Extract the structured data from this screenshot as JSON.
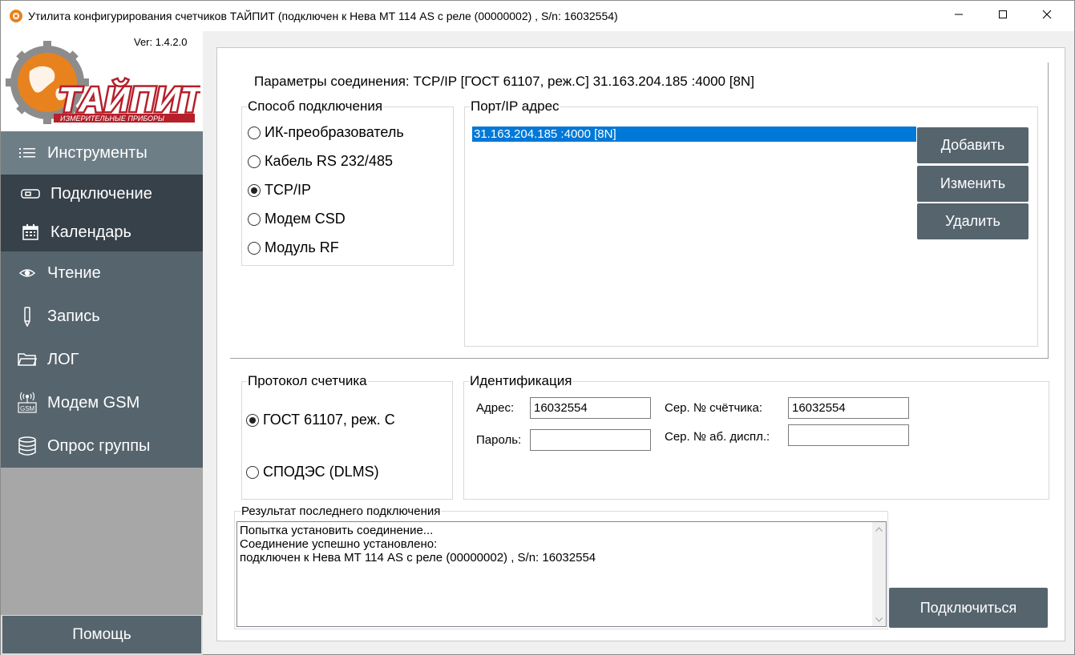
{
  "window": {
    "title": "Утилита конфигурирования счетчиков ТАЙПИТ (подключен к Нева МТ 114 AS с реле (00000002) , S/n: 16032554)",
    "controls": {
      "minimize": "minimize-icon",
      "maximize": "maximize-icon",
      "close": "close-icon"
    }
  },
  "sidebar": {
    "version": "Ver: 1.4.2.0",
    "logo_text": "ТАЙПИТ",
    "logo_subtext": "ИЗМЕРИТЕЛЬНЫЕ ПРИБОРЫ",
    "items": [
      {
        "label": "Инструменты",
        "icon": "list-icon"
      },
      {
        "label": "Подключение",
        "icon": "connector-icon",
        "active": true
      },
      {
        "label": "Календарь",
        "icon": "calendar-icon"
      },
      {
        "label": "Чтение",
        "icon": "eye-icon"
      },
      {
        "label": "Запись",
        "icon": "pencil-icon"
      },
      {
        "label": "ЛОГ",
        "icon": "folder-icon"
      },
      {
        "label": "Модем GSM",
        "icon": "gsm-icon"
      },
      {
        "label": "Опрос группы",
        "icon": "database-icon"
      }
    ],
    "help_label": "Помощь"
  },
  "main": {
    "connection_params": "Параметры соединения: TCP/IP [ГОСТ 61107, реж.С] 31.163.204.185 :4000 [8N]",
    "method_group": {
      "title": "Способ подключения",
      "options": [
        {
          "label": "ИК-преобразователь",
          "checked": false
        },
        {
          "label": "Кабель RS 232/485",
          "checked": false
        },
        {
          "label": "TCP/IP",
          "checked": true
        },
        {
          "label": "Модем CSD",
          "checked": false
        },
        {
          "label": "Модуль RF",
          "checked": false
        }
      ]
    },
    "port_group": {
      "title": "Порт/IP адрес",
      "entries": [
        "31.163.204.185 :4000 [8N]"
      ],
      "add_label": "Добавить",
      "edit_label": "Изменить",
      "delete_label": "Удалить"
    },
    "protocol_group": {
      "title": "Протокол счетчика",
      "options": [
        {
          "label": "ГОСТ 61107, реж. С",
          "checked": true
        },
        {
          "label": "СПОДЭС (DLMS)",
          "checked": false
        }
      ]
    },
    "ident_group": {
      "title": "Идентификация",
      "address_label": "Адрес:",
      "address_value": "16032554",
      "password_label": "Пароль:",
      "password_value": "",
      "serial_label": "Сер. № счётчика:",
      "serial_value": "16032554",
      "display_serial_label": "Сер. № аб. диспл.:",
      "display_serial_value": ""
    },
    "result_group": {
      "title": "Результат последнего подключения",
      "lines": [
        "Попытка установить соединение...",
        "Соединение успешно установлено:",
        "подключен к Нева МТ 114 AS с реле (00000002) , S/n: 16032554"
      ]
    },
    "connect_label": "Подключиться"
  }
}
